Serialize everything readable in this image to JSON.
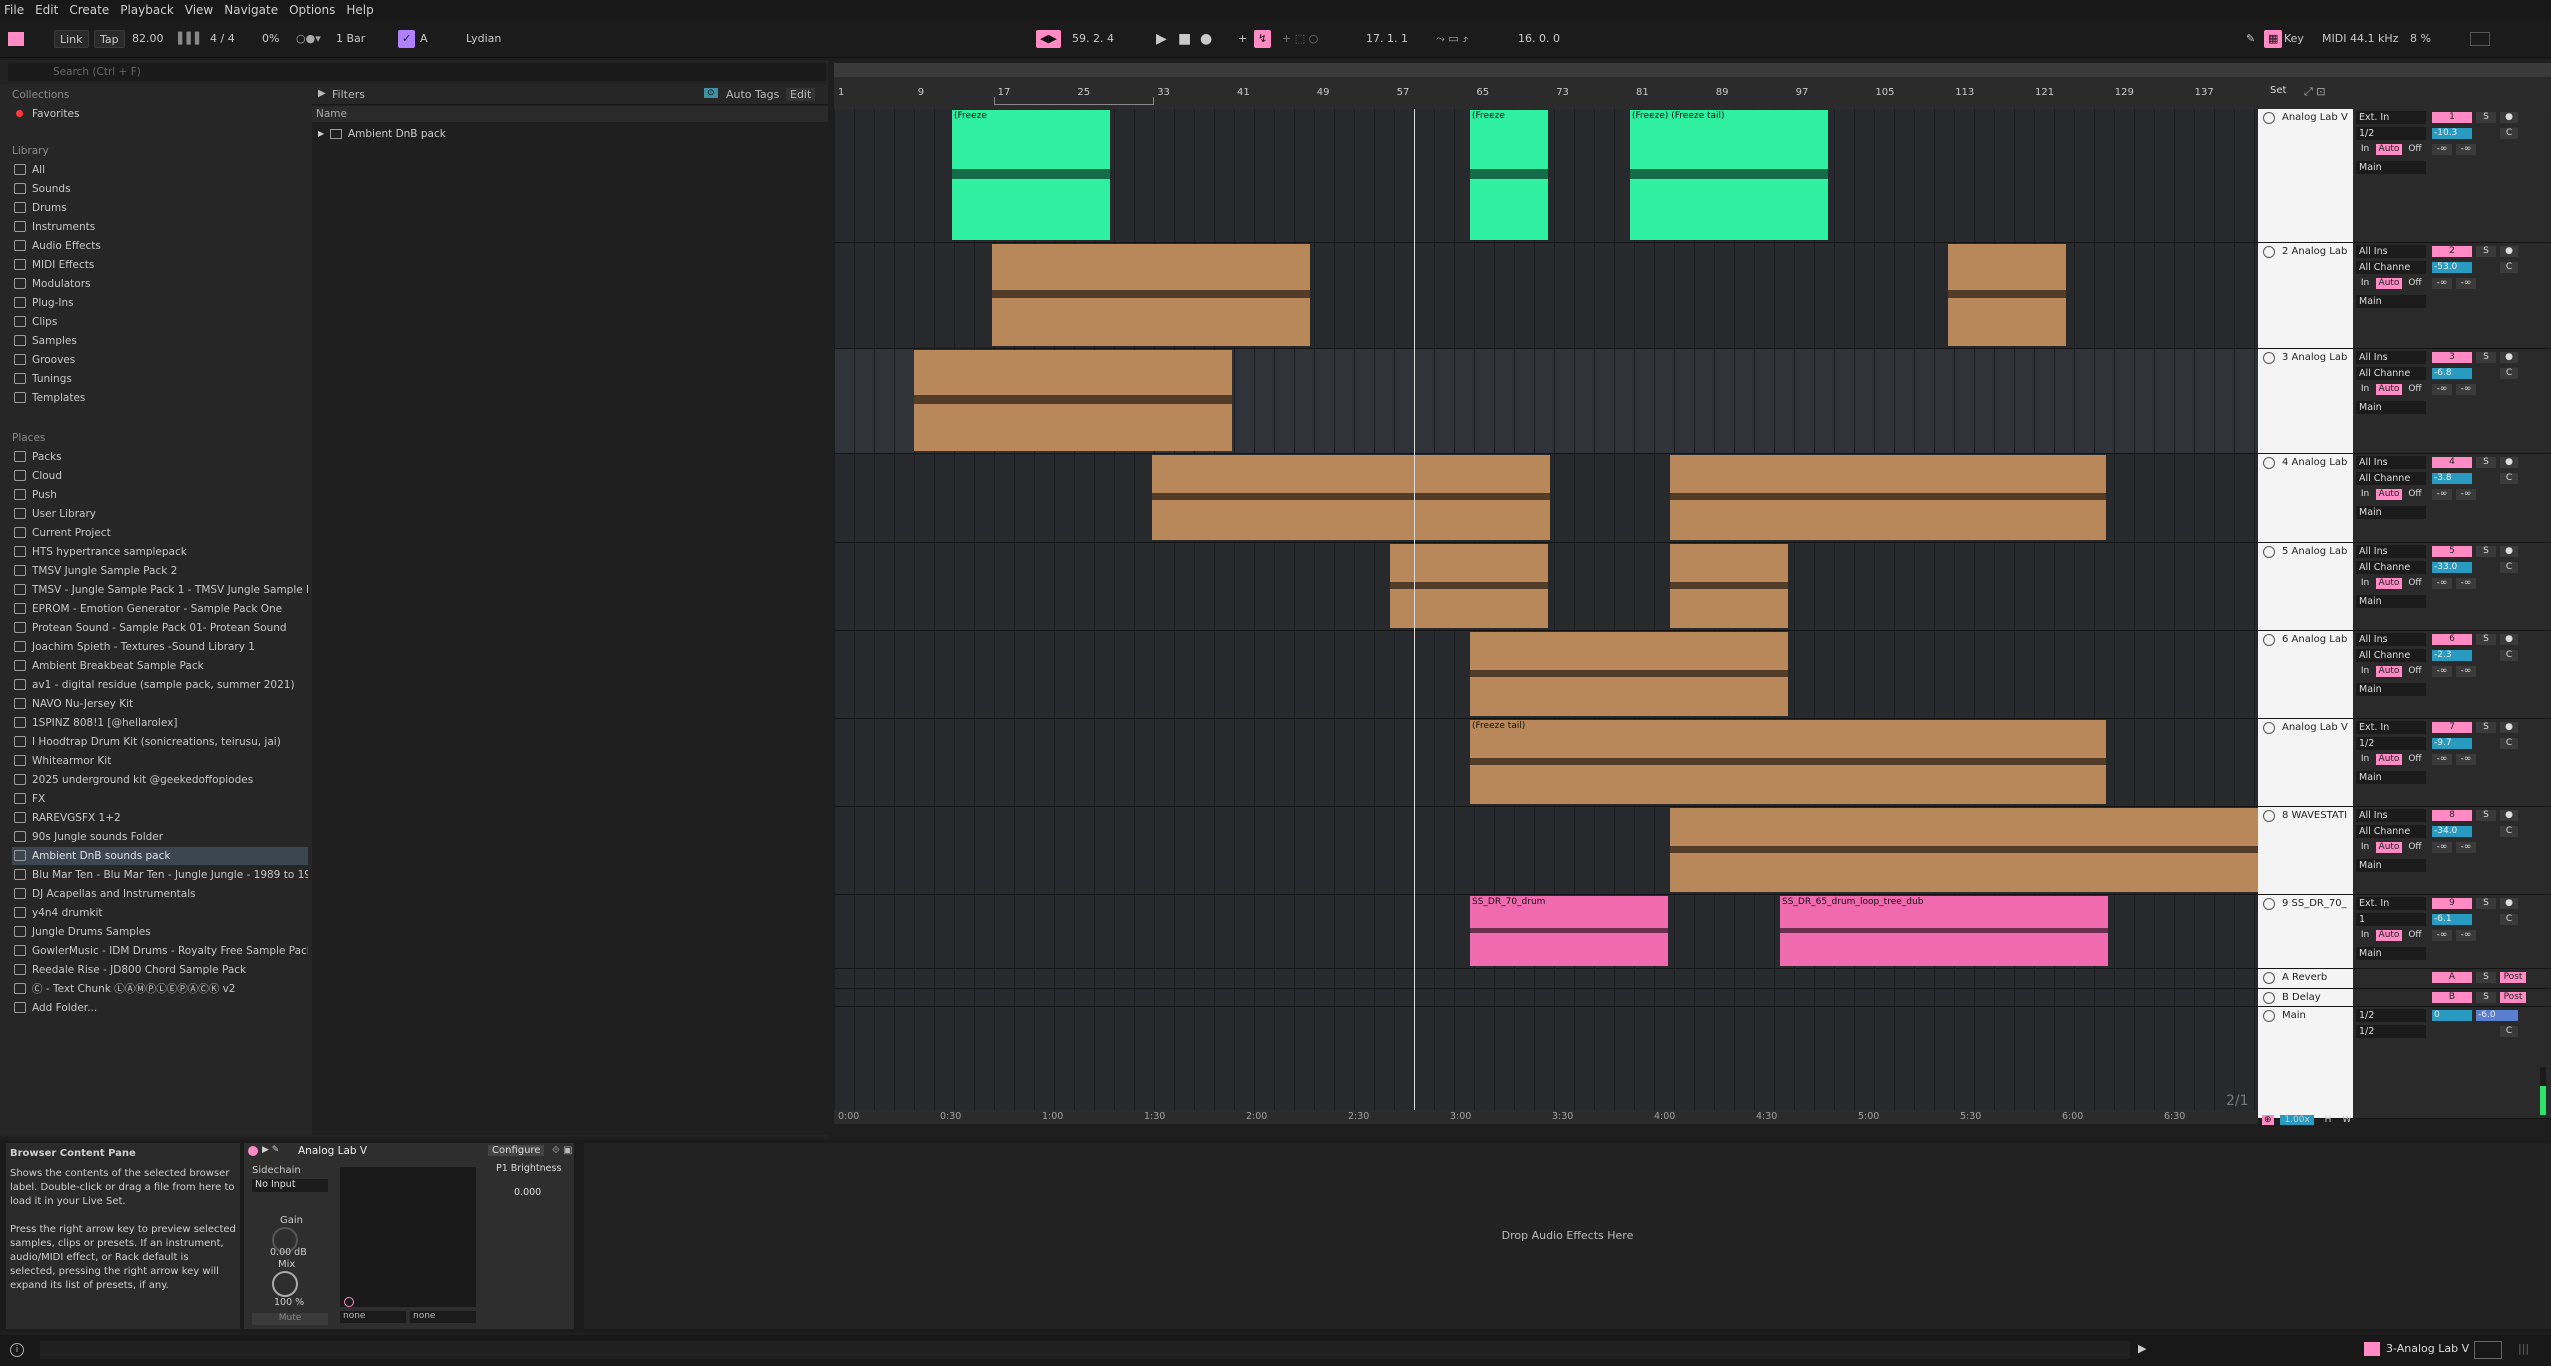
{
  "menu": [
    "File",
    "Edit",
    "Create",
    "Playback",
    "View",
    "Navigate",
    "Options",
    "Help"
  ],
  "transport": {
    "link": "Link",
    "tap": "Tap",
    "tempo": "82.00",
    "time_sig": "4 / 4",
    "swing": "0%",
    "quantize": "1 Bar",
    "key": "A",
    "scale": "Lydian",
    "position": "59.   2.   4",
    "loop_start": "17.   1.   1",
    "loop_length": "16.   0.   0",
    "key_label": "Key",
    "midi_label": "MIDI",
    "sample_rate": "44.1 kHz",
    "cpu": "8 %"
  },
  "browser": {
    "search_placeholder": "Search (Ctrl + F)",
    "collections_title": "Collections",
    "favorites": "Favorites",
    "library_title": "Library",
    "library_items": [
      "All",
      "Sounds",
      "Drums",
      "Instruments",
      "Audio Effects",
      "MIDI Effects",
      "Modulators",
      "Plug-Ins",
      "Clips",
      "Samples",
      "Grooves",
      "Tunings",
      "Templates"
    ],
    "places_title": "Places",
    "places_items": [
      "Packs",
      "Cloud",
      "Push",
      "User Library",
      "Current Project",
      "HTS hypertrance samplepack",
      "TMSV Jungle Sample Pack 2",
      "TMSV - Jungle Sample Pack 1 - TMSV Jungle Sample Pac",
      "EPROM - Emotion Generator - Sample Pack One",
      "Protean Sound - Sample Pack 01- Protean Sound",
      "Joachim Spieth - Textures -Sound Library 1",
      "Ambient Breakbeat Sample Pack",
      "av1 - digital residue (sample pack, summer 2021)",
      "NAVO Nu-Jersey Kit",
      "1SPINZ 808!1 [@hellarolex]",
      "I Hoodtrap Drum Kit (sonicreations, teirusu, jai)",
      "Whitearmor Kit",
      "2025 underground kit @geekedoffopiodes",
      "FX",
      "RAREVGSFX 1+2",
      "90s Jungle sounds Folder",
      "Ambient DnB sounds pack",
      "Blu Mar Ten - Blu Mar Ten - Jungle Jungle - 1989 to 1999",
      "DJ Acapellas and Instrumentals",
      "y4n4 drumkit",
      "Jungle Drums Samples",
      "GowlerMusic - IDM Drums - Royalty Free Sample Pack #",
      "Reedale Rise - JD800 Chord Sample Pack",
      "Ⓒ - Text Chunk ⓁⒶⓂⓅⓁⒺⓅⒶⒸⓀ v2",
      "Add Folder..."
    ],
    "selected_place": "Ambient DnB sounds pack",
    "filters_label": "Filters",
    "auto_tags": "Auto Tags",
    "edit": "Edit",
    "name_col": "Name",
    "content_items": [
      "Ambient DnB pack"
    ]
  },
  "ruler": {
    "bars": [
      "1",
      "9",
      "17",
      "25",
      "33",
      "41",
      "49",
      "57",
      "65",
      "73",
      "81",
      "89",
      "97",
      "105",
      "113",
      "121",
      "129",
      "137"
    ],
    "times": [
      "0:00",
      "0:30",
      "1:00",
      "1:30",
      "2:00",
      "2:30",
      "3:00",
      "3:30",
      "4:00",
      "4:30",
      "5:00",
      "5:30",
      "6:00",
      "6:30"
    ],
    "set_label": "Set",
    "page_indicator": "2/1",
    "zoom": "1.00x"
  },
  "tracks": [
    {
      "name": "Analog Lab V",
      "input": "Ext. In",
      "channel": "1/2",
      "num": "1",
      "vol": "-10.3",
      "color": "#2fefa0"
    },
    {
      "name": "2 Analog Lab",
      "input": "All Ins",
      "channel": "All Channe",
      "num": "2",
      "vol": "-53.0",
      "color": "#b8875a"
    },
    {
      "name": "3 Analog Lab",
      "input": "All Ins",
      "channel": "All Channe",
      "num": "3",
      "vol": "-6.8",
      "color": "#b8875a"
    },
    {
      "name": "4 Analog Lab",
      "input": "All Ins",
      "channel": "All Channe",
      "num": "4",
      "vol": "-3.8",
      "color": "#b8875a"
    },
    {
      "name": "5 Analog Lab",
      "input": "All Ins",
      "channel": "All Channe",
      "num": "5",
      "vol": "-33.0",
      "color": "#b8875a"
    },
    {
      "name": "6 Analog Lab",
      "input": "All Ins",
      "channel": "All Channe",
      "num": "6",
      "vol": "-2.3",
      "color": "#b8875a"
    },
    {
      "name": "Analog Lab V",
      "input": "Ext. In",
      "channel": "1/2",
      "num": "7",
      "vol": "-9.7",
      "color": "#b8875a"
    },
    {
      "name": "8 WAVESTATI",
      "input": "All Ins",
      "channel": "All Channe",
      "num": "8",
      "vol": "-34.0",
      "color": "#b8875a"
    },
    {
      "name": "9 SS_DR_70_",
      "input": "Ext. In",
      "channel": "1",
      "num": "9",
      "vol": "-6.1",
      "color": "#f06ab0"
    }
  ],
  "returns": [
    {
      "name": "A Reverb",
      "letter": "A",
      "post": "Post"
    },
    {
      "name": "B Delay",
      "letter": "B",
      "post": "Post"
    }
  ],
  "main": {
    "name": "Main",
    "ch": "1/2",
    "vol": "0",
    "pan": "-6.0"
  },
  "mixer_labels": {
    "in": "In",
    "auto": "Auto",
    "off": "Off",
    "main": "Main",
    "s": "S",
    "c": "C",
    "inf": "-∞"
  },
  "clips": {
    "freeze": "(Freeze",
    "freeze_tail": "(Freeze tail)",
    "freeze2": "(Freeze) (Freeze tail)",
    "ss70": "SS_DR_70_drum",
    "ss70b": "SS_DR_70_drum",
    "ssdr": "SS_DR",
    "ss65": "SS_DR_65_drum_loop_tree_dub",
    "s": "S"
  },
  "info": {
    "title": "Browser Content Pane",
    "body1": "Shows the contents of the selected browser label. Double-click or drag a file from here to load it in your Live Set.",
    "body2": "Press the right arrow key to preview selected samples, clips or presets. If an instrument, audio/MIDI effect, or Rack default is selected, pressing the right arrow key will expand its list of presets, if any."
  },
  "device": {
    "name": "Analog Lab V",
    "sidechain": "Sidechain",
    "no_input": "No Input",
    "gain": "Gain",
    "gain_val": "0.00 dB",
    "mix": "Mix",
    "mix_val": "100 %",
    "mute": "Mute",
    "configure": "Configure",
    "param": "P1 Brightness",
    "param_val": "0.000",
    "none1": "none",
    "none2": "none"
  },
  "drop_text": "Drop Audio Effects Here",
  "status": {
    "track": "3-Analog Lab V"
  }
}
